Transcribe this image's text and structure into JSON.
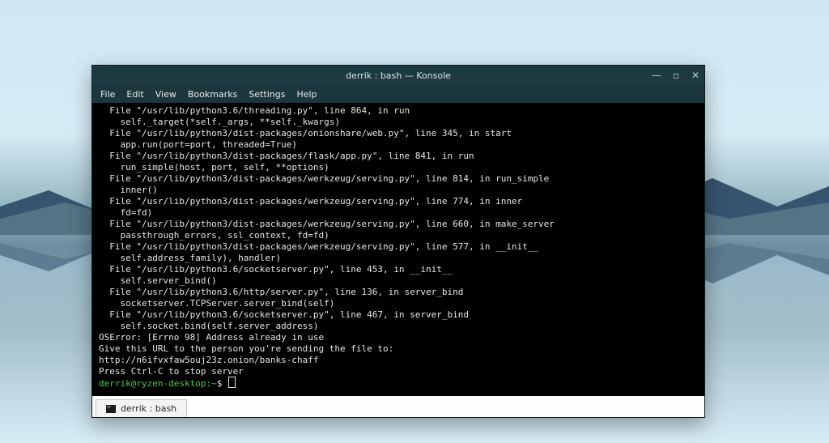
{
  "window": {
    "title": "derrik : bash — Konsole"
  },
  "menu": {
    "file": "File",
    "edit": "Edit",
    "view": "View",
    "bookmarks": "Bookmarks",
    "settings": "Settings",
    "help": "Help"
  },
  "terminal": {
    "lines": [
      "  File \"/usr/lib/python3.6/threading.py\", line 864, in run",
      "    self._target(*self._args, **self._kwargs)",
      "  File \"/usr/lib/python3/dist-packages/onionshare/web.py\", line 345, in start",
      "    app.run(port=port, threaded=True)",
      "  File \"/usr/lib/python3/dist-packages/flask/app.py\", line 841, in run",
      "    run_simple(host, port, self, **options)",
      "  File \"/usr/lib/python3/dist-packages/werkzeug/serving.py\", line 814, in run_simple",
      "    inner()",
      "  File \"/usr/lib/python3/dist-packages/werkzeug/serving.py\", line 774, in inner",
      "    fd=fd)",
      "  File \"/usr/lib/python3/dist-packages/werkzeug/serving.py\", line 660, in make_server",
      "    passthrough_errors, ssl_context, fd=fd)",
      "  File \"/usr/lib/python3/dist-packages/werkzeug/serving.py\", line 577, in __init__",
      "    self.address_family), handler)",
      "  File \"/usr/lib/python3.6/socketserver.py\", line 453, in __init__",
      "    self.server_bind()",
      "  File \"/usr/lib/python3.6/http/server.py\", line 136, in server_bind",
      "    socketserver.TCPServer.server_bind(self)",
      "  File \"/usr/lib/python3.6/socketserver.py\", line 467, in server_bind",
      "    self.socket.bind(self.server_address)",
      "OSError: [Errno 98] Address already in use",
      "",
      "Give this URL to the person you're sending the file to:",
      "http://n6ifvxfaw5ouj23z.onion/banks-chaff",
      "",
      "Press Ctrl-C to stop server"
    ],
    "prompt_user": "derrik@ryzen-desktop",
    "prompt_path": "~",
    "prompt_symbol": "$"
  },
  "tab": {
    "label": "derrik : bash"
  }
}
